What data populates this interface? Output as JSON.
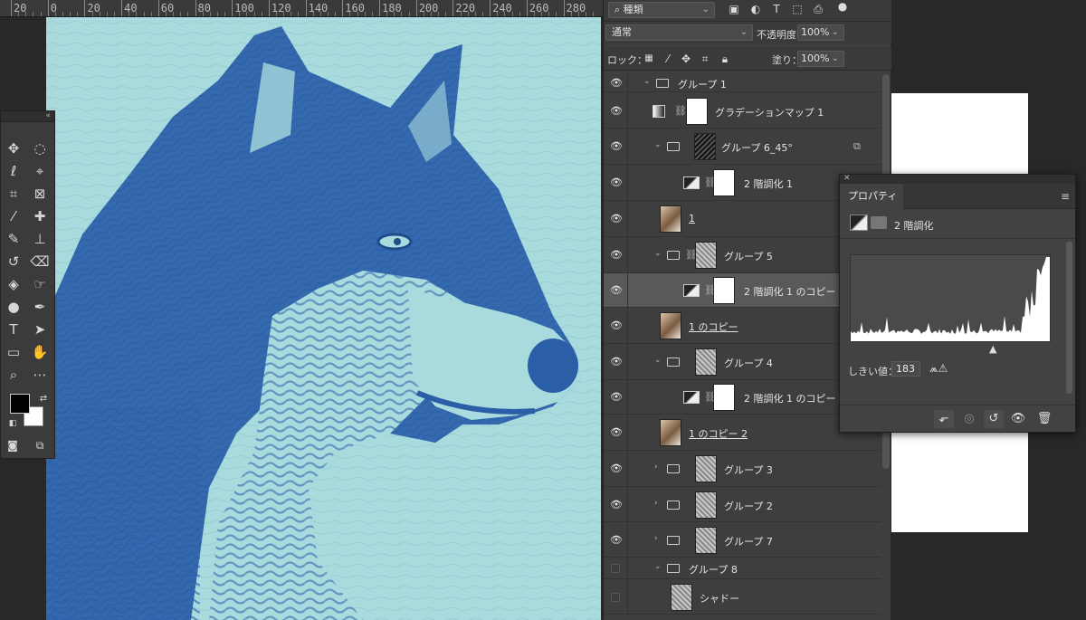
{
  "ruler": {
    "labels": [
      "20",
      "0",
      "20",
      "40",
      "60",
      "80",
      "100",
      "120",
      "140",
      "160",
      "180",
      "200",
      "220",
      "240",
      "260",
      "280"
    ]
  },
  "layers_panel": {
    "filter_kind": "種類",
    "blend_mode": "通常",
    "opacity_label": "不透明度：",
    "opacity_value": "100%",
    "lock_label": "ロック：",
    "fill_label": "塗り：",
    "fill_value": "100%",
    "layers": [
      {
        "name": "グループ 1",
        "visible": true
      },
      {
        "name": "グラデーションマップ 1",
        "visible": true
      },
      {
        "name": "グループ 6_45°",
        "visible": true
      },
      {
        "name": "2 階調化 1",
        "visible": true
      },
      {
        "name": "1",
        "visible": true
      },
      {
        "name": "グループ 5",
        "visible": true
      },
      {
        "name": "2 階調化 1 のコピー",
        "visible": true,
        "selected": true
      },
      {
        "name": "1 のコピー",
        "visible": true
      },
      {
        "name": "グループ 4",
        "visible": true
      },
      {
        "name": "2 階調化 1 のコピー 2",
        "visible": true
      },
      {
        "name": "1 のコピー 2",
        "visible": true
      },
      {
        "name": "グループ 3",
        "visible": true
      },
      {
        "name": "グループ 2",
        "visible": true
      },
      {
        "name": "グループ 7",
        "visible": true
      },
      {
        "name": "グループ 8",
        "visible": false
      },
      {
        "name": "シャドー",
        "visible": false
      }
    ]
  },
  "properties_panel": {
    "tab": "プロパティ",
    "adjustment_name": "2 階調化",
    "threshold_label": "しきい値：",
    "threshold_value": "183"
  },
  "colors": {
    "canvas_bg": "#a9dadd",
    "wolf_blue": "#2a5fa8"
  },
  "icons": [
    "search-icon",
    "image-filter-icon",
    "adjust-filter-icon",
    "type-filter-icon",
    "shape-filter-icon",
    "smart-filter-icon",
    "eye-icon",
    "link-icon",
    "folder-icon",
    "clip-arrow-icon",
    "lock-pixels-icon",
    "lock-brush-icon",
    "lock-move-icon",
    "lock-artboard-icon",
    "lock-all-icon",
    "menu-icon",
    "clip-to-layer-icon",
    "view-previous-icon",
    "reset-icon",
    "visibility-icon",
    "trash-icon",
    "histogram-warning-icon"
  ]
}
